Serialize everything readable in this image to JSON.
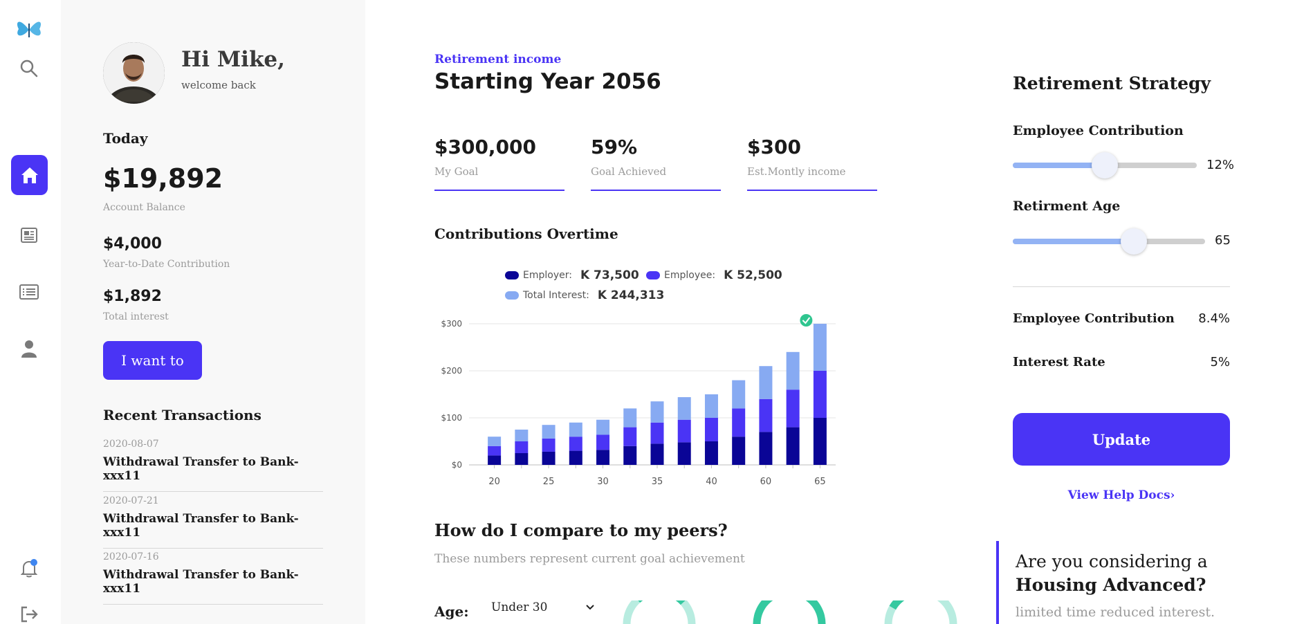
{
  "nav": {
    "items": [
      "butterfly-logo",
      "search",
      "home",
      "news",
      "list",
      "profile",
      "notifications",
      "logout"
    ]
  },
  "user": {
    "greeting": "Hi Mike,",
    "welcome": "welcome back"
  },
  "summary": {
    "today_label": "Today",
    "balance": "$19,892",
    "balance_label": "Account Balance",
    "ytd": "$4,000",
    "ytd_label": "Year-to-Date Contribution",
    "interest": "$1,892",
    "interest_label": "Total interest",
    "action_button": "I want to"
  },
  "transactions": {
    "title": "Recent Transactions",
    "items": [
      {
        "date": "2020-08-07",
        "desc": "Withdrawal Transfer to Bank-xxx11"
      },
      {
        "date": "2020-07-21",
        "desc": "Withdrawal Transfer to Bank-xxx11"
      },
      {
        "date": "2020-07-16",
        "desc": "Withdrawal Transfer to Bank-xxx11"
      }
    ]
  },
  "income": {
    "eyebrow": "Retirement income",
    "title": "Starting Year 2056",
    "stats": [
      {
        "value": "$300,000",
        "label": "My Goal"
      },
      {
        "value": "59%",
        "label": "Goal Achieved"
      },
      {
        "value": "$300",
        "label": "Est.Montly income"
      }
    ]
  },
  "contributions": {
    "title": "Contributions Overtime",
    "legend": [
      {
        "label": "Employer:",
        "value": "K 73,500",
        "color": "#0a0596"
      },
      {
        "label": "Employee:",
        "value": "K 52,500",
        "color": "#4a34f5"
      },
      {
        "label": "Total Interest:",
        "value": "K 244,313",
        "color": "#87aaf2"
      }
    ]
  },
  "chart_data": {
    "type": "bar",
    "stacked": true,
    "x_tick_labels": [
      "20",
      "25",
      "30",
      "35",
      "40",
      "60",
      "65"
    ],
    "y_tick_labels": [
      "$0",
      "$100",
      "$200",
      "$300"
    ],
    "ylim": [
      0,
      300
    ],
    "grid": true,
    "series": [
      {
        "name": "Employer",
        "color": "#0a0596",
        "values": [
          20,
          25,
          28,
          30,
          32,
          40,
          45,
          48,
          50,
          60,
          70,
          80,
          100
        ]
      },
      {
        "name": "Employee",
        "color": "#4a34f5",
        "values": [
          20,
          25,
          28,
          30,
          32,
          40,
          45,
          48,
          50,
          60,
          70,
          80,
          100
        ]
      },
      {
        "name": "Total Interest",
        "color": "#87aaf2",
        "values": [
          20,
          25,
          29,
          30,
          32,
          40,
          45,
          48,
          50,
          60,
          70,
          80,
          100
        ]
      }
    ],
    "marker": "check-icon on final bar"
  },
  "peers": {
    "title": "How do I compare to my peers?",
    "subtitle": "These numbers represent current goal achievement",
    "age_label": "Age:",
    "age_value": "Under 30"
  },
  "strategy": {
    "title": "Retirement Strategy",
    "employee_contribution_label": "Employee Contribution",
    "employee_contribution_value": "12%",
    "employee_contribution_fraction": 0.5,
    "retirement_age_label": "Retirment Age",
    "retirement_age_value": "65",
    "retirement_age_fraction": 0.63,
    "rows": [
      {
        "label": "Employee Contribution",
        "value": "8.4%"
      },
      {
        "label": "Interest Rate",
        "value": "5%"
      }
    ],
    "update_button": "Update",
    "help_link": "View Help Docs"
  },
  "promo": {
    "line1": "Are you considering a",
    "line2": "Housing Advanced?",
    "sub": "limited time reduced interest."
  }
}
